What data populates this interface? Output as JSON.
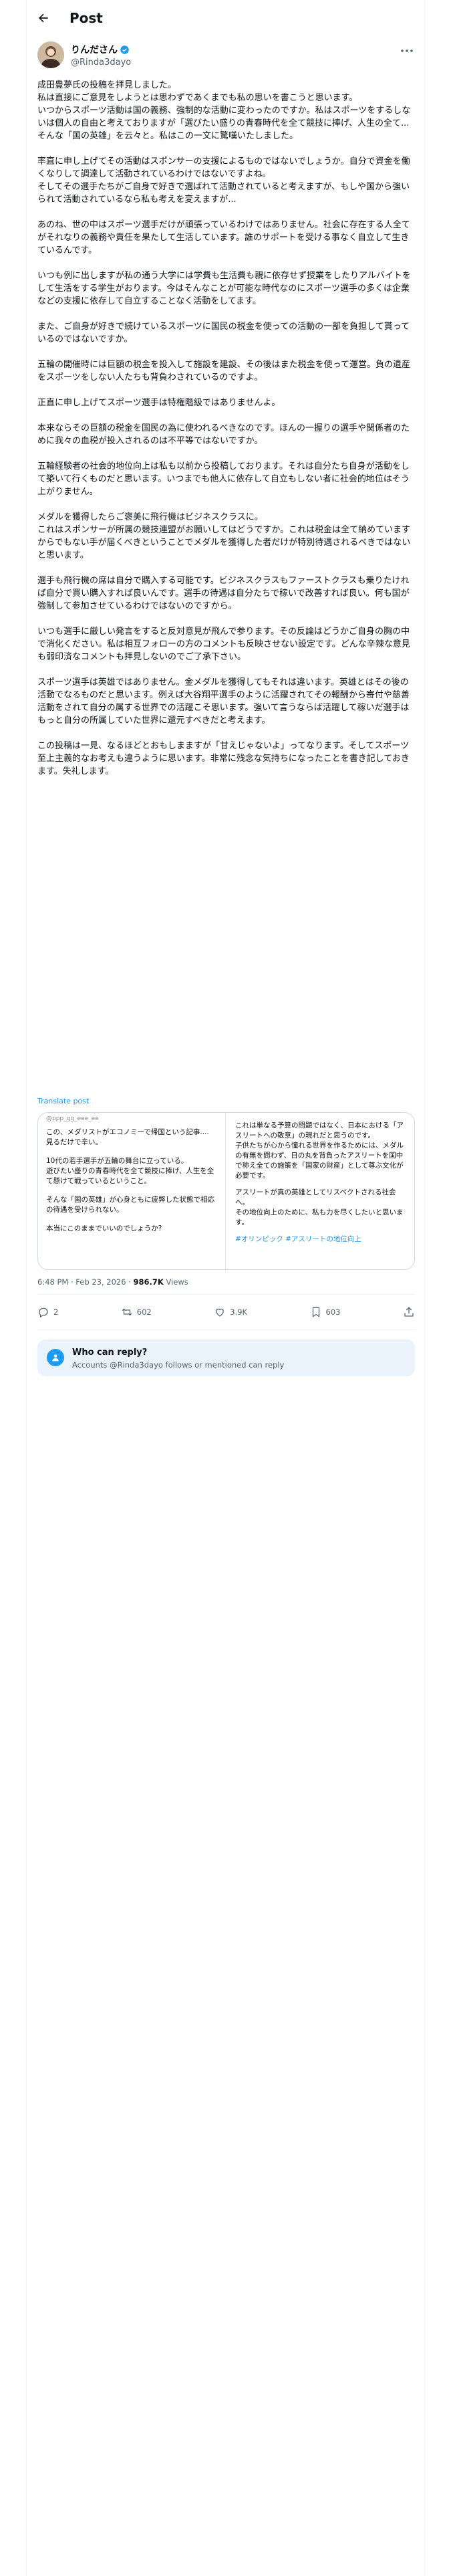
{
  "header": {
    "title": "Post"
  },
  "author": {
    "display_name": "りんださん",
    "handle": "@Rinda3dayo"
  },
  "post_paragraphs": [
    "成田豊夢氏の投稿を拝見しました。\n私は直接にご意見をしようとは思わずであくまでも私の思いを書こうと思います。\nいつからスポーツ活動は国の義務、強制的な活動に変わったのですか。私はスポーツをするしないは個人の自由と考えておりますが「選びたい盛りの青春時代を全て競技に捧げ、人生の全て...\nそんな「国の英雄」を云々と。私はこの一文に驚嘆いたしました。",
    "率直に申し上げてその活動はスポンサーの支援によるものではないでしょうか。自分で資金を働くなりして調達して活動されているわけではないですよね。\nそしてその選手たちがご自身で好きで選ばれて活動されていると考えますが、もしや国から強いられて活動されているなら私も考えを変えますが...",
    "あのね、世の中はスポーツ選手だけが頑張っているわけではありません。社会に存在する人全てがそれなりの義務や責任を果たして生活しています。誰のサポートを受ける事なく自立して生きているんです。",
    "いつも例に出しますが私の通う大学には学費も生活費も親に依存せず授業をしたりアルバイトをして生活をする学生がおります。今はそんなことが可能な時代なのにスポーツ選手の多くは企業などの支援に依存して自立することなく活動をしてます。",
    "また、ご自身が好きで続けているスポーツに国民の税金を使っての活動の一部を負担して貰っているのではないですか。",
    "五輪の開催時には巨額の税金を投入して施設を建設、その後はまた税金を使って運営。負の遺産をスポーツをしない人たちも背負わされているのですよ。",
    "正直に申し上げてスポーツ選手は特権階級ではありませんよ。",
    "本来ならその巨額の税金を国民の為に使われるべきなのです。ほんの一握りの選手や関係者のために我々の血税が投入されるのは不平等ではないですか。",
    "五輪経験者の社会的地位向上は私も以前から投稿しております。それは自分たち自身が活動をして築いて行くものだと思います。いつまでも他人に依存して自立もしない者に社会的地位はそう上がりません。",
    "メダルを獲得したらご褒美に飛行機はビジネスクラスに。\nこれはスポンサーが所属の競技連盟がお願いしてはどうですか。これは税金は全て納めていますからでもない手が届くべきということでメダルを獲得した者だけが特別待遇されるべきではないと思います。",
    "選手も飛行機の席は自分で購入する可能です。ビジネスクラスもファーストクラスも乗りたければ自分で買い購入すれば良いんです。選手の待遇は自分たちで稼いで改善すれば良い。何も国が強制して参加させているわけではないのですから。",
    "いつも選手に厳しい発言をすると反対意見が飛んで参ります。その反論はどうかご自身の胸の中で消化ください。私は相互フォローの方のコメントも反映させない設定です。どんな辛辣な意見も弱印済なコメントも拝見しないのでご了承下さい。",
    "スポーツ選手は英雄ではありません。金メダルを獲得してもそれは違います。英雄とはその後の活動でなるものだと思います。例えば大谷翔平選手のように活躍されてその報酬から寄付や慈善活動をされて自分の属する世界での活躍こそ思います。強いて言うならば活躍して稼いだ選手はもっと自分の所属していた世界に還元すべきだと考えます。",
    "この投稿は一見、なるほどとおもしまますが「甘えじゃないよ」ってなります。そしてスポーツ至上主義的なお考えも違うように思います。非常に残念な気持ちになったことを書き記しておきます。失礼します。"
  ],
  "translate_link": "Translate post",
  "quote": {
    "header": "@ppp_gg_eee_ee",
    "left_paragraphs": [
      "この、メダリストがエコノミーで帰国という記事....\n見るだけで辛い。",
      "10代の若手選手が五輪の舞台に立っている。\n遊びたい盛りの青春時代を全て競技に捧げ、人生を全て懸けて戦っているということ。",
      "そんな「国の英雄」が心身ともに疲弊した状態で相応の待遇を受けられない。",
      "本当にこのままでいいのでしょうか?"
    ],
    "right_paragraphs": [
      "これは単なる予算の問題ではなく、日本における「アスリートへの敬意」の現れだと思うのです。\n子供たちが心から憧れる世界を作るためには、メダルの有無を問わず、日の丸を背負ったアスリートを国中で称え全ての施策を「国家の財産」として尊ぶ文化が必要です。",
      "アスリートが真の英雄としてリスペクトされる社会へ。\nその地位向上のために、私も力を尽くしたいと思います。"
    ],
    "hashtags": "#オリンピック #アスリートの地位向上"
  },
  "meta": {
    "time": "6:48 PM · Feb 23, 2026",
    "views_count": "986.7K",
    "views_label": "Views"
  },
  "actions": {
    "replies": "2",
    "reposts": "602",
    "likes": "3.9K",
    "bookmarks": "603"
  },
  "reply_box": {
    "title": "Who can reply?",
    "subtitle": "Accounts @Rinda3dayo follows or mentioned can reply"
  },
  "colors": {
    "accent": "#1d9bf0",
    "text": "#0f1419",
    "muted": "#536471",
    "verified": "#1d9bf0"
  }
}
